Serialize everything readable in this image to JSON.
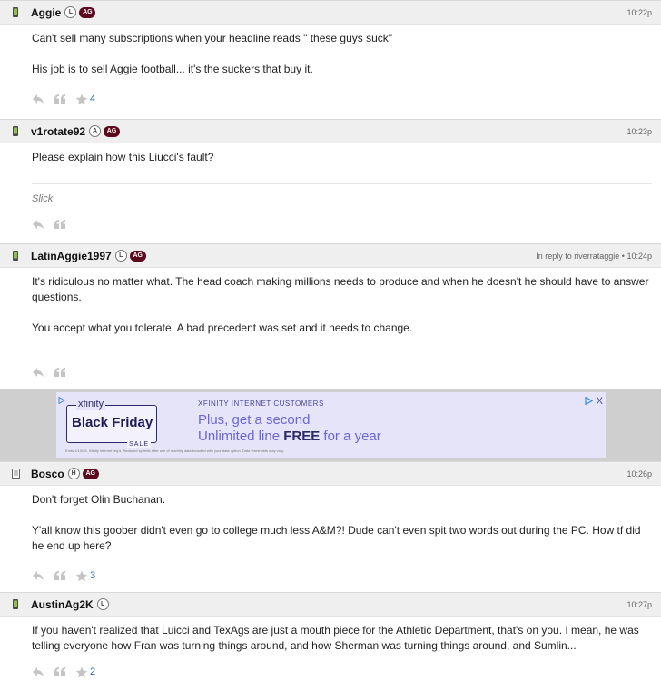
{
  "posts": [
    {
      "username": "Aggie",
      "badge": "L",
      "team": "AG",
      "time": "10:22p",
      "paragraphs": [
        "Can't sell many subscriptions when your headline reads \" these guys suck\"",
        "His job is to sell Aggie football... it's the suckers that buy it."
      ],
      "stars": "4"
    },
    {
      "username": "v1rotate92",
      "badge": "A",
      "team": "AG",
      "time": "10:23p",
      "paragraphs": [
        "Please explain how this Liucci's fault?"
      ],
      "signature": "Slick"
    },
    {
      "username": "LatinAggie1997",
      "badge": "L",
      "team": "AG",
      "reply_to": "In reply to riverrataggie • 10:24p",
      "paragraphs": [
        "It's ridiculous no matter what. The head coach making millions needs to produce and when he doesn't he should have to answer questions.",
        "You accept what you tolerate. A bad precedent was set and it needs to change."
      ]
    },
    {
      "username": "Bosco",
      "badge": "H",
      "team": "AG",
      "time": "10:26p",
      "paragraphs": [
        "Don't forget Olin Buchanan.",
        "Y'all know this goober didn't even go to college much less A&M?! Dude can't even spit two words out during the PC. How tf did he end up here?"
      ],
      "stars": "3"
    },
    {
      "username": "AustinAg2K",
      "badge": "L",
      "time": "10:27p",
      "paragraphs": [
        "If you haven't realized that Luicci and TexAgs are just a mouth piece for the Athletic Department, that's on you. I mean, he was telling everyone how Fran was turning things around, and how Sherman was turning things around, and Sumlin..."
      ],
      "stars": "2"
    }
  ],
  "ad": {
    "logo": "xfinity",
    "headline": "Black Friday",
    "sale": "SALE",
    "small": "XFINITY INTERNET CUSTOMERS",
    "line1": "Plus, get a second",
    "line2_pre": "Unlimited line ",
    "line2_bold": "FREE",
    "line2_post": " for a year",
    "fine": "Ends 1/10/25. Xfinity Internet req'd. Reduced speeds after use of monthly data included with your data option. Data thresholds may vary.",
    "close": "X",
    "accent": "#2d2a6b"
  },
  "icons": {
    "device_mobile": "phone-icon",
    "device_desktop": "document-icon",
    "reply": "reply-arrow-icon",
    "quote": "quote-icon",
    "star": "star-icon"
  }
}
